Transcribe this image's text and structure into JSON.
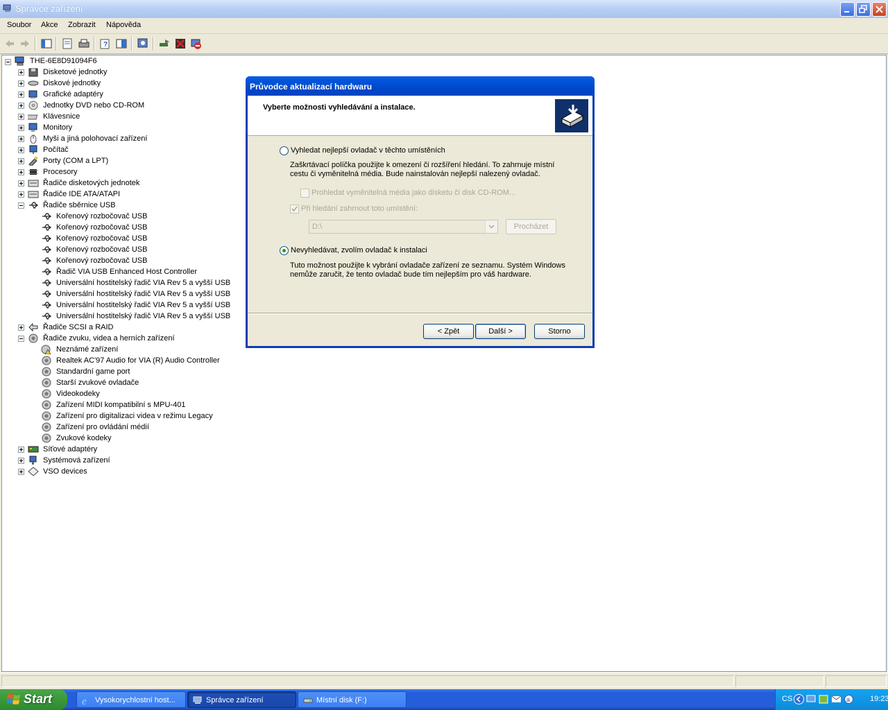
{
  "window": {
    "title": "Správce zařízení",
    "menu": [
      "Soubor",
      "Akce",
      "Zobrazit",
      "Nápověda"
    ]
  },
  "toolbar": {
    "icons": [
      "back-icon",
      "forward-icon",
      "console-tree-icon",
      "properties-icon",
      "print-icon",
      "help-icon",
      "action-pane-icon",
      "scan-hardware-icon",
      "update-driver-icon",
      "uninstall-icon",
      "disable-icon"
    ]
  },
  "tree": {
    "root": "THE-6E8D91094F6",
    "items": [
      {
        "label": "Disketové jednotky",
        "level": 1,
        "expander": "plus",
        "icon": "floppy-icon"
      },
      {
        "label": "Diskové jednotky",
        "level": 1,
        "expander": "plus",
        "icon": "disk-icon"
      },
      {
        "label": "Grafické adaptéry",
        "level": 1,
        "expander": "plus",
        "icon": "display-adapter-icon"
      },
      {
        "label": "Jednotky DVD nebo CD-ROM",
        "level": 1,
        "expander": "plus",
        "icon": "cdrom-icon"
      },
      {
        "label": "Klávesnice",
        "level": 1,
        "expander": "plus",
        "icon": "keyboard-icon"
      },
      {
        "label": "Monitory",
        "level": 1,
        "expander": "plus",
        "icon": "monitor-icon"
      },
      {
        "label": "Myši a jiná polohovací zařízení",
        "level": 1,
        "expander": "plus",
        "icon": "mouse-icon"
      },
      {
        "label": "Počítač",
        "level": 1,
        "expander": "plus",
        "icon": "computer-icon"
      },
      {
        "label": "Porty (COM a LPT)",
        "level": 1,
        "expander": "plus",
        "icon": "port-icon"
      },
      {
        "label": "Procesory",
        "level": 1,
        "expander": "plus",
        "icon": "processor-icon"
      },
      {
        "label": "Řadiče disketových jednotek",
        "level": 1,
        "expander": "plus",
        "icon": "controller-icon"
      },
      {
        "label": "Řadiče IDE ATA/ATAPI",
        "level": 1,
        "expander": "plus",
        "icon": "controller-icon"
      },
      {
        "label": "Řadiče sběrnice USB",
        "level": 1,
        "expander": "minus",
        "icon": "usb-icon"
      },
      {
        "label": "Kořenový rozbočovač USB",
        "level": 2,
        "expander": "",
        "icon": "usb-icon"
      },
      {
        "label": "Kořenový rozbočovač USB",
        "level": 2,
        "expander": "",
        "icon": "usb-icon"
      },
      {
        "label": "Kořenový rozbočovač USB",
        "level": 2,
        "expander": "",
        "icon": "usb-icon"
      },
      {
        "label": "Kořenový rozbočovač USB",
        "level": 2,
        "expander": "",
        "icon": "usb-icon"
      },
      {
        "label": "Kořenový rozbočovač USB",
        "level": 2,
        "expander": "",
        "icon": "usb-icon"
      },
      {
        "label": "Řadič VIA USB Enhanced Host Controller",
        "level": 2,
        "expander": "",
        "icon": "usb-icon"
      },
      {
        "label": "Universální hostitelský řadič VIA Rev 5 a vyšší USB",
        "level": 2,
        "expander": "",
        "icon": "usb-icon"
      },
      {
        "label": "Universální hostitelský řadič VIA Rev 5 a vyšší USB",
        "level": 2,
        "expander": "",
        "icon": "usb-icon"
      },
      {
        "label": "Universální hostitelský řadič VIA Rev 5 a vyšší USB",
        "level": 2,
        "expander": "",
        "icon": "usb-icon"
      },
      {
        "label": "Universální hostitelský řadič VIA Rev 5 a vyšší USB",
        "level": 2,
        "expander": "",
        "icon": "usb-icon"
      },
      {
        "label": "Řadiče SCSI a RAID",
        "level": 1,
        "expander": "plus",
        "icon": "scsi-icon"
      },
      {
        "label": "Řadiče zvuku, videa a herních zařízení",
        "level": 1,
        "expander": "minus",
        "icon": "sound-icon"
      },
      {
        "label": "Neznámé zařízení",
        "level": 2,
        "expander": "",
        "icon": "warning-device-icon"
      },
      {
        "label": "Realtek AC'97 Audio for VIA (R) Audio Controller",
        "level": 2,
        "expander": "",
        "icon": "sound-icon"
      },
      {
        "label": "Standardní game port",
        "level": 2,
        "expander": "",
        "icon": "sound-icon"
      },
      {
        "label": "Starší zvukové ovladače",
        "level": 2,
        "expander": "",
        "icon": "sound-icon"
      },
      {
        "label": "Videokodeky",
        "level": 2,
        "expander": "",
        "icon": "sound-icon"
      },
      {
        "label": "Zařízení MIDI kompatibilní s MPU-401",
        "level": 2,
        "expander": "",
        "icon": "sound-icon"
      },
      {
        "label": "Zařízení pro digitalizaci videa v režimu Legacy",
        "level": 2,
        "expander": "",
        "icon": "sound-icon"
      },
      {
        "label": "Zařízení pro ovládání médií",
        "level": 2,
        "expander": "",
        "icon": "sound-icon"
      },
      {
        "label": "Zvukové kodeky",
        "level": 2,
        "expander": "",
        "icon": "sound-icon"
      },
      {
        "label": "Síťové adaptéry",
        "level": 1,
        "expander": "plus",
        "icon": "network-icon"
      },
      {
        "label": "Systémová zařízení",
        "level": 1,
        "expander": "plus",
        "icon": "system-icon"
      },
      {
        "label": "VSO devices",
        "level": 1,
        "expander": "plus",
        "icon": "vso-icon"
      }
    ]
  },
  "dialog": {
    "title": "Průvodce aktualizací hardwaru",
    "heading": "Vyberte možnosti vyhledávání a instalace.",
    "option1": {
      "label": "Vyhledat nejlepší ovladač v těchto umístěních",
      "desc1": "Zaškrtávací políčka použijte k omezení či rozšíření hledání. To zahrnuje místní",
      "desc2": "cestu či vyměnitelná média. Bude nainstalován nejlepší nalezený ovladač.",
      "selected": false
    },
    "check1": {
      "label": "Prohledat vyměnitelná média jako disketu či disk CD-ROM...",
      "checked": false
    },
    "check2": {
      "label": "Při hledání zahrnout toto umístění:",
      "checked": true
    },
    "path_value": "D:\\",
    "browse_label": "Procházet",
    "option2": {
      "label": "Nevyhledávat, zvolím ovladač k instalaci",
      "desc1": "Tuto možnost použijte k vybrání ovladače zařízení ze seznamu. Systém Windows",
      "desc2": "nemůže zaručit, že tento ovladač bude tím nejlepším pro váš hardware.",
      "selected": true
    },
    "back_label": "< Zpět",
    "next_label": "Další >",
    "cancel_label": "Storno"
  },
  "taskbar": {
    "start_label": "Start",
    "tasks": [
      {
        "label": "Vysokorychlostní host...",
        "icon": "ie-icon",
        "active": false
      },
      {
        "label": "Správce zařízení",
        "icon": "device-manager-icon",
        "active": true
      },
      {
        "label": "Místní disk (F:)",
        "icon": "drive-icon",
        "active": false
      }
    ],
    "language": "CS",
    "clock": "19:23"
  },
  "colors": {
    "titlebar_inactive": "#bcd2f5",
    "dialog_title": "#0052d6",
    "taskbar": "#245edb",
    "start_button": "#3c9b3c",
    "radio_dot": "#21a121"
  }
}
